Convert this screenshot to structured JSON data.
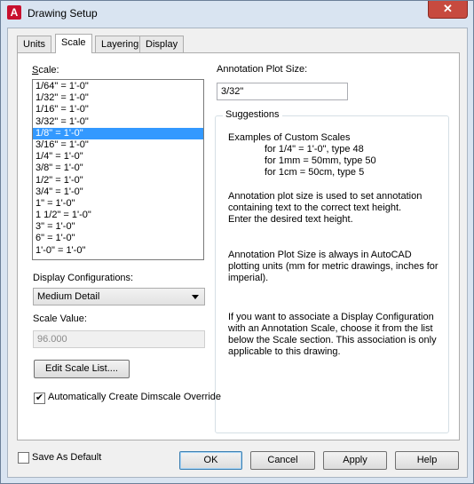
{
  "window": {
    "title": "Drawing Setup",
    "app_icon": "A",
    "close_glyph": "✕"
  },
  "tabs": [
    "Units",
    "Scale",
    "Layering",
    "Display"
  ],
  "scale": {
    "label": "Scale:",
    "items": [
      "1/64\" = 1'-0\"",
      "1/32\" = 1'-0\"",
      "1/16\" = 1'-0\"",
      "3/32\" = 1'-0\"",
      "1/8\" = 1'-0\"",
      "3/16\" = 1'-0\"",
      "1/4\" = 1'-0\"",
      "3/8\" = 1'-0\"",
      "1/2\" = 1'-0\"",
      "3/4\" = 1'-0\"",
      "1\" = 1'-0\"",
      "1 1/2\" = 1'-0\"",
      "3\" = 1'-0\"",
      "6\" = 1'-0\"",
      "1'-0\" = 1'-0\""
    ],
    "selected": "1/8\" = 1'-0\""
  },
  "display_config": {
    "label": "Display Configurations:",
    "value": "Medium Detail"
  },
  "scale_value": {
    "label": "Scale Value:",
    "value": "96.000"
  },
  "edit_scale_button": "Edit Scale List....",
  "dimscale_checkbox": {
    "label": "Automatically Create Dimscale Override",
    "checked": true
  },
  "annotation": {
    "label": "Annotation Plot Size:",
    "value": "3/32\""
  },
  "suggestions": {
    "title": "Suggestions",
    "examples_title": "Examples of Custom Scales",
    "examples": [
      "for 1/4\" = 1'-0\", type 48",
      "for 1mm = 50mm, type 50",
      "for 1cm = 50cm, type 5"
    ],
    "para1": [
      "Annotation plot size is used to set annotation",
      "containing text to the correct text height.",
      "Enter the desired text height."
    ],
    "para2": [
      "Annotation Plot Size is always in AutoCAD",
      "plotting units (mm for metric drawings, inches for",
      "imperial)."
    ],
    "para3": [
      "If you want to associate a Display Configuration",
      "with an Annotation Scale, choose it from the list",
      "below the Scale section.  This association is only",
      "applicable to this drawing."
    ]
  },
  "save_default": {
    "label": "Save As Default",
    "checked": false
  },
  "buttons": {
    "ok": "OK",
    "cancel": "Cancel",
    "apply": "Apply",
    "help": "Help"
  }
}
